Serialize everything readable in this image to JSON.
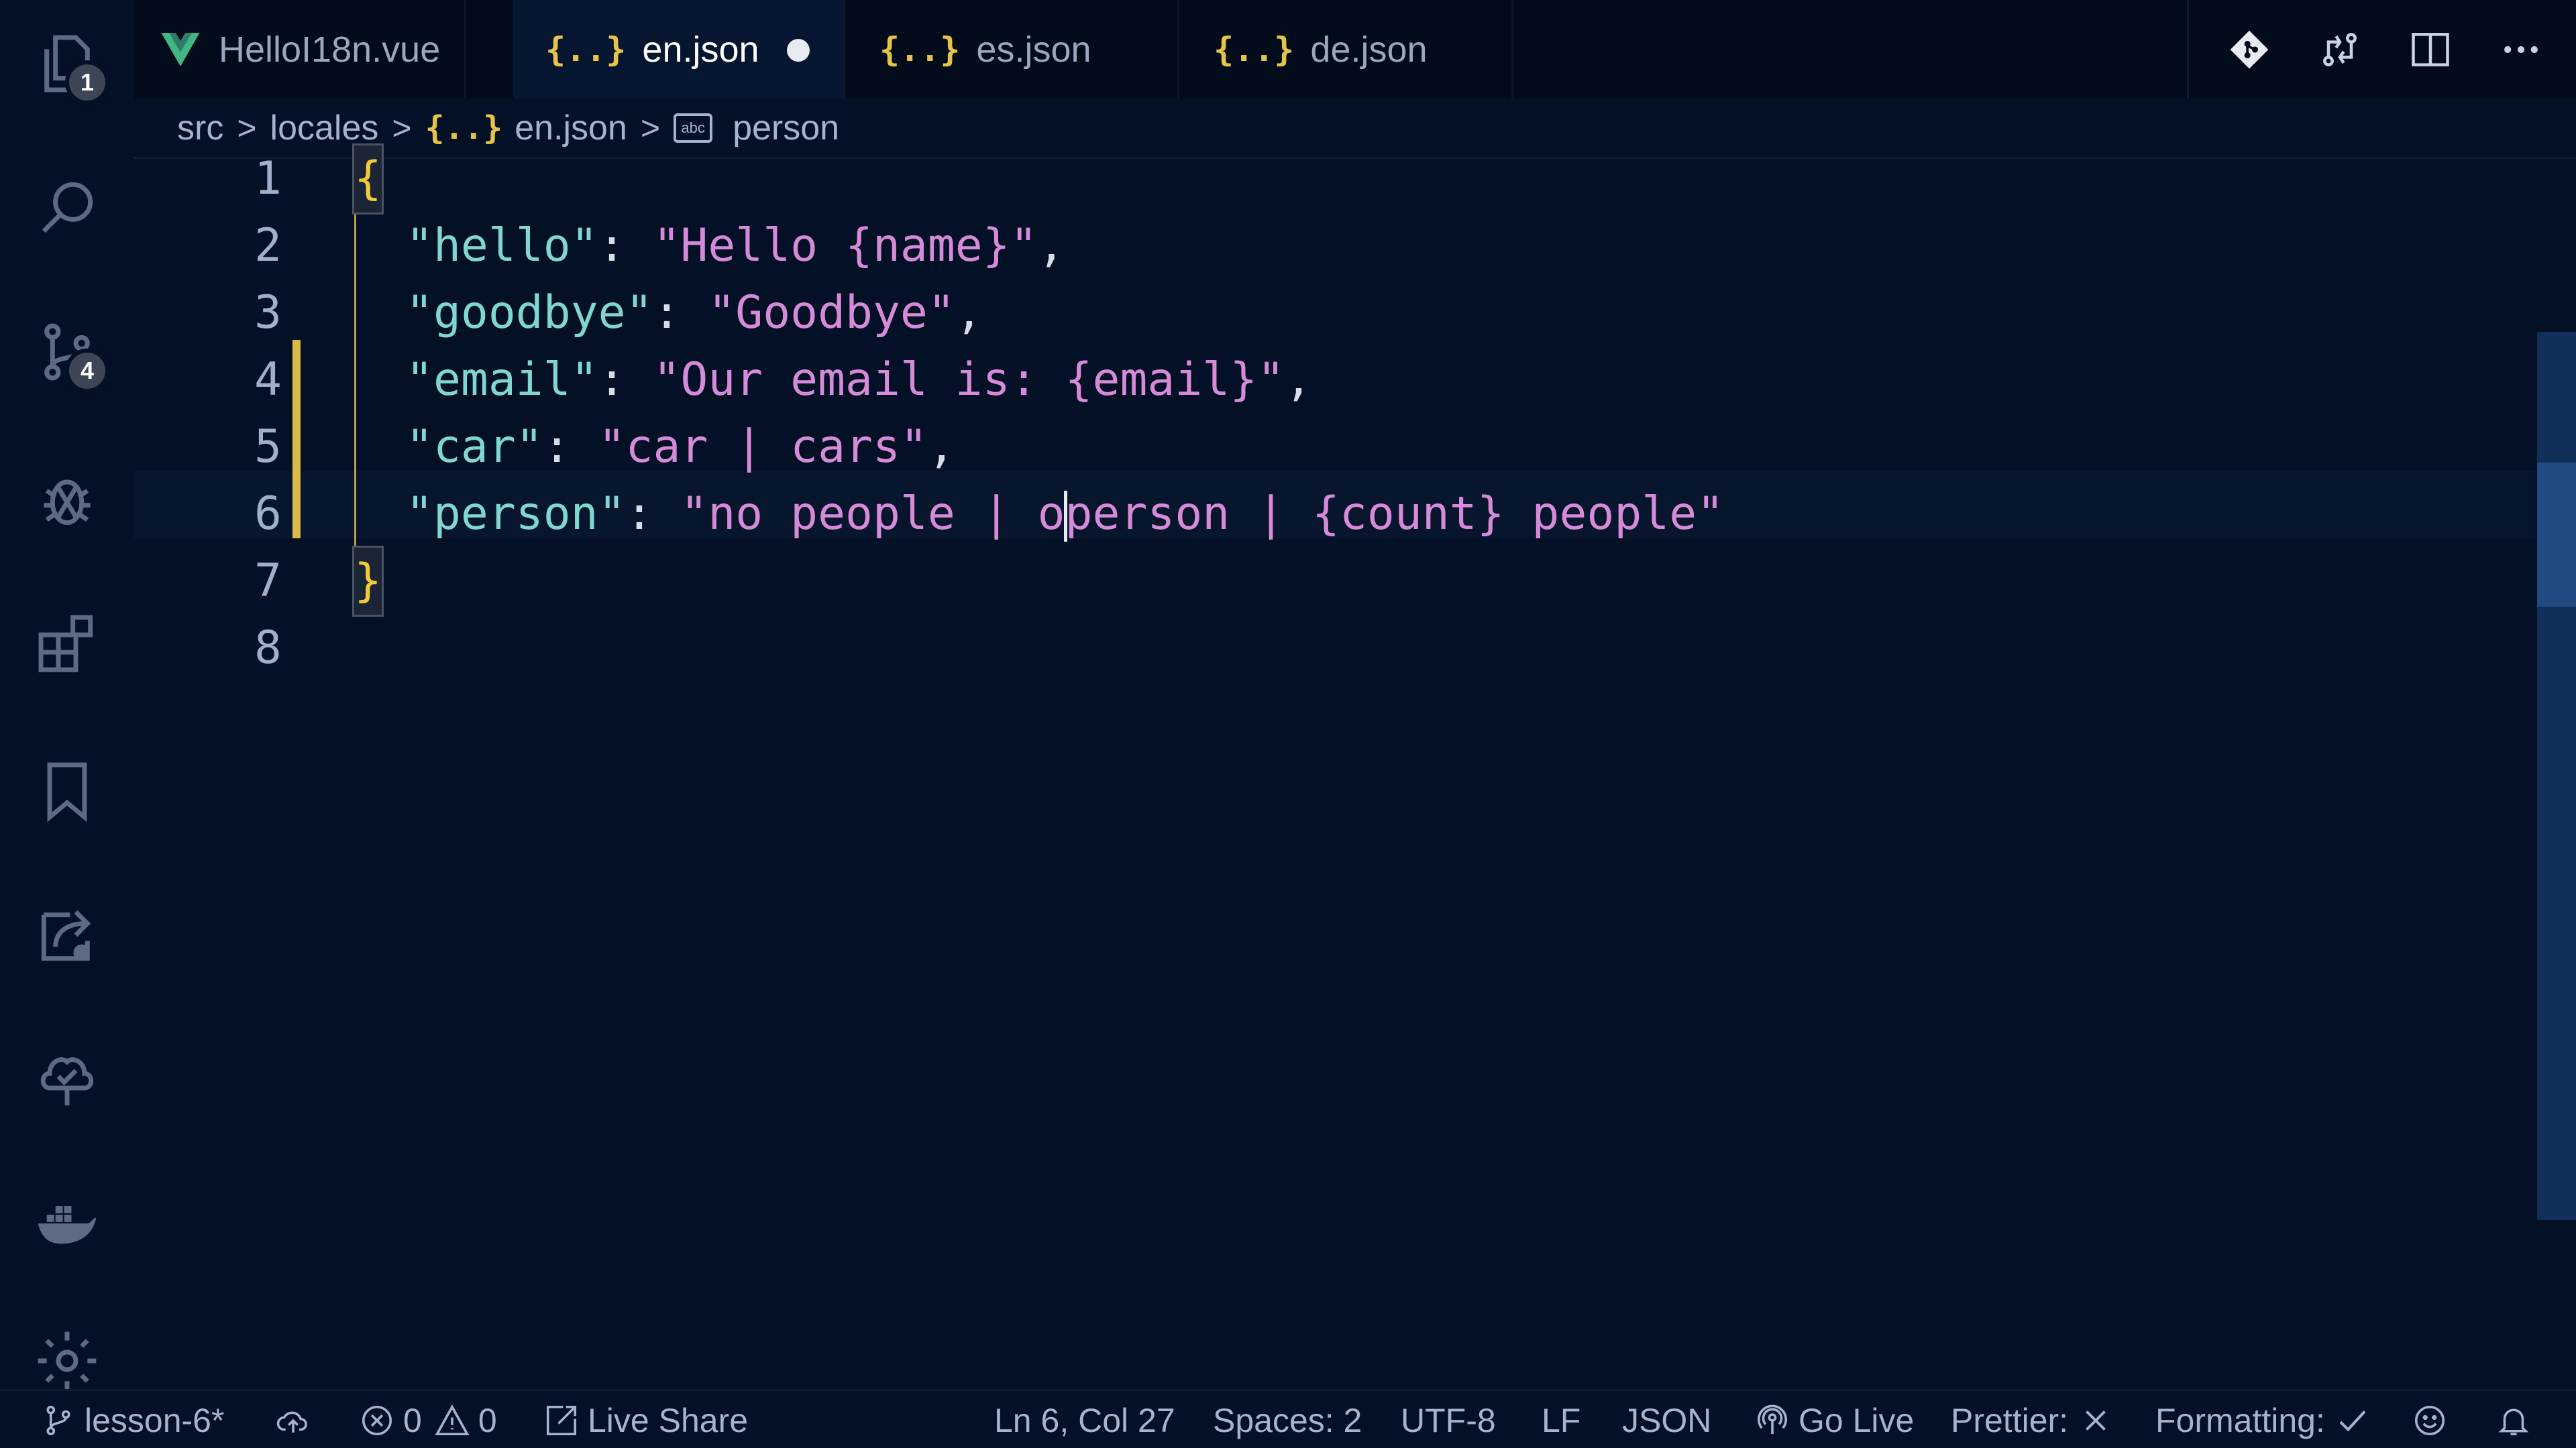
{
  "activity_bar": {
    "explorer_badge": "1",
    "source_control_badge": "4",
    "icons": [
      "files-icon",
      "search-icon",
      "source-control-icon",
      "debug-icon",
      "extensions-icon",
      "bookmark-icon",
      "live-share-icon",
      "tree-icon",
      "docker-icon",
      "settings-icon"
    ]
  },
  "tabs": [
    {
      "label": "HelloI18n.vue",
      "icon": "vue-icon",
      "active": false
    },
    {
      "label": "en.json",
      "icon": "json-icon",
      "active": true,
      "dirty": true
    },
    {
      "label": "es.json",
      "icon": "json-icon",
      "active": false
    },
    {
      "label": "de.json",
      "icon": "json-icon",
      "active": false
    }
  ],
  "json_icon_glyph": "{..}",
  "breadcrumb": {
    "items": [
      "src",
      "locales",
      "en.json",
      "person"
    ],
    "separator": ">",
    "abc_glyph": "abc"
  },
  "editor": {
    "line_numbers": [
      "1",
      "2",
      "3",
      "4",
      "5",
      "6",
      "7",
      "8"
    ],
    "lines": [
      {
        "brace": "{"
      },
      {
        "key": "\"hello\"",
        "colon": ": ",
        "value": "\"Hello {name}\"",
        "tail": ","
      },
      {
        "key": "\"goodbye\"",
        "colon": ": ",
        "value": "\"Goodbye\"",
        "tail": ","
      },
      {
        "key": "\"email\"",
        "colon": ": ",
        "value": "\"Our email is: {email}\"",
        "tail": ","
      },
      {
        "key": "\"car\"",
        "colon": ": ",
        "value": "\"car | cars\"",
        "tail": ","
      },
      {
        "key": "\"person\"",
        "colon": ": ",
        "value_before_cursor": "\"no people | o",
        "value_after_cursor": "person | {count} people\"",
        "tail": ""
      },
      {
        "brace": "}"
      },
      {}
    ],
    "cursor_line": 6
  },
  "status_bar": {
    "branch": "lesson-6*",
    "errors": "0",
    "warnings": "0",
    "live_share": "Live Share",
    "position": "Ln 6, Col 27",
    "spaces": "Spaces: 2",
    "encoding": "UTF-8",
    "eol": "LF",
    "language": "JSON",
    "go_live": "Go Live",
    "prettier": "Prettier:",
    "formatting": "Formatting:"
  },
  "colors": {
    "background": "#031025",
    "json_key": "#7fd7d0",
    "json_value": "#d68ad8",
    "brace": "#f2cc36",
    "modified_gutter": "#d8b94a"
  }
}
